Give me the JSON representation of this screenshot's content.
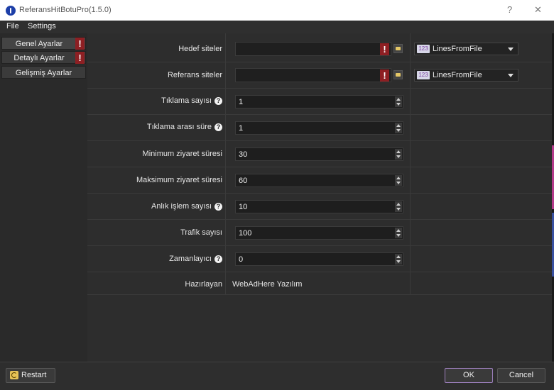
{
  "window": {
    "title": "ReferansHitBotuPro(1.5.0)",
    "help_glyph": "?",
    "close_glyph": "✕"
  },
  "menu": {
    "file": "File",
    "settings": "Settings"
  },
  "nav": {
    "items": [
      {
        "label": "Genel Ayarlar",
        "warning": "!"
      },
      {
        "label": "Detaylı Ayarlar",
        "warning": "!"
      },
      {
        "label": "Gelişmiş Ayarlar"
      }
    ]
  },
  "form": {
    "hedef": {
      "label": "Hedef siteler",
      "value": "",
      "warning": "!",
      "source_badge": "123",
      "source": "LinesFromFile"
    },
    "referans": {
      "label": "Referans siteler",
      "value": "",
      "warning": "!",
      "source_badge": "123",
      "source": "LinesFromFile"
    },
    "tiklama": {
      "label": "Tıklama sayısı",
      "value": "1",
      "help": "?"
    },
    "tiklama_arasi": {
      "label": "Tıklama arası süre",
      "value": "1",
      "help": "?"
    },
    "min_ziyaret": {
      "label": "Minimum ziyaret süresi",
      "value": "30"
    },
    "max_ziyaret": {
      "label": "Maksimum ziyaret süresi",
      "value": "60"
    },
    "anlik": {
      "label": "Anlık işlem sayısı",
      "value": "10",
      "help": "?"
    },
    "trafik": {
      "label": "Trafik sayısı",
      "value": "100"
    },
    "zamanlayici": {
      "label": "Zamanlayıcı",
      "value": "0",
      "help": "?"
    },
    "hazirlayan": {
      "label": "Hazırlayan",
      "value": "WebAdHere Yazılım"
    }
  },
  "buttons": {
    "restart": "Restart",
    "ok": "OK",
    "cancel": "Cancel"
  },
  "colors": {
    "warning": "#8e1f23",
    "accent_border": "#9d7fbd",
    "background": "#2d2d2d"
  }
}
